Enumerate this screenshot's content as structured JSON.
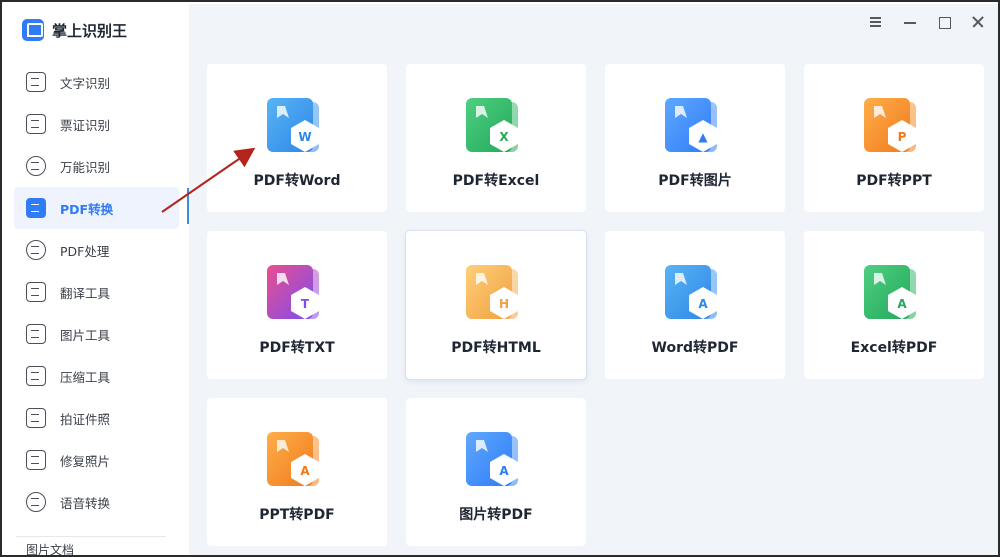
{
  "app": {
    "name": "掌上识别王"
  },
  "sidebar": {
    "items": [
      {
        "label": "文字识别",
        "icon": "text-scan-icon",
        "active": false
      },
      {
        "label": "票证识别",
        "icon": "ticket-icon",
        "active": false
      },
      {
        "label": "万能识别",
        "icon": "universal-scan-icon",
        "active": false
      },
      {
        "label": "PDF转换",
        "icon": "pdf-icon",
        "active": true
      },
      {
        "label": "PDF处理",
        "icon": "pdf-process-icon",
        "active": false
      },
      {
        "label": "翻译工具",
        "icon": "translate-icon",
        "active": false
      },
      {
        "label": "图片工具",
        "icon": "image-icon",
        "active": false
      },
      {
        "label": "压缩工具",
        "icon": "compress-icon",
        "active": false
      },
      {
        "label": "拍证件照",
        "icon": "id-photo-icon",
        "active": false
      },
      {
        "label": "修复照片",
        "icon": "photo-repair-icon",
        "active": false
      },
      {
        "label": "语音转换",
        "icon": "voice-icon",
        "active": false
      }
    ],
    "more_label": "图片文档"
  },
  "window": {
    "menu_icon": "menu-icon",
    "minimize_icon": "minimize-icon",
    "maximize_icon": "maximize-icon",
    "close_icon": "close-icon"
  },
  "tools": [
    {
      "label": "PDF转Word",
      "letter": "W",
      "color": "#2f86e6",
      "color2": "#58b4f5"
    },
    {
      "label": "PDF转Excel",
      "letter": "X",
      "color": "#23a85a",
      "color2": "#4fcf82"
    },
    {
      "label": "PDF转图片",
      "letter": "▲",
      "color": "#2f7cf6",
      "color2": "#5fa8ff"
    },
    {
      "label": "PDF转PPT",
      "letter": "P",
      "color": "#f07a1c",
      "color2": "#ffae4a"
    },
    {
      "label": "PDF转TXT",
      "letter": "T",
      "color": "#7d4cf0",
      "color2": "#e94f8d"
    },
    {
      "label": "PDF转HTML",
      "letter": "H",
      "color": "#f0a040",
      "color2": "#ffcf7a"
    },
    {
      "label": "Word转PDF",
      "letter": "A",
      "color": "#2f86e6",
      "color2": "#58b4f5"
    },
    {
      "label": "Excel转PDF",
      "letter": "A",
      "color": "#23a85a",
      "color2": "#4fcf82"
    },
    {
      "label": "PPT转PDF",
      "letter": "A",
      "color": "#f07a1c",
      "color2": "#ffae4a"
    },
    {
      "label": "图片转PDF",
      "letter": "A",
      "color": "#2f7cf6",
      "color2": "#5fa8ff"
    }
  ]
}
